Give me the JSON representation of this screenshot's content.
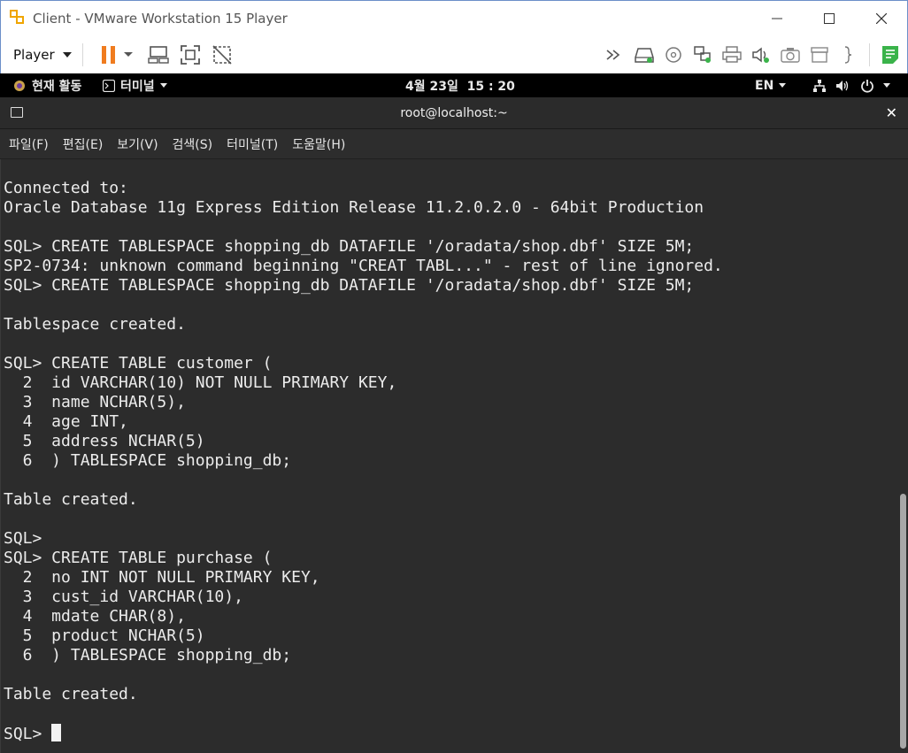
{
  "window": {
    "title": "Client - VMware Workstation 15 Player",
    "controls": [
      "minimize-icon",
      "maximize-icon",
      "close-icon"
    ]
  },
  "toolbar": {
    "player_label": "Player",
    "left_icons": [
      "pause-icon",
      "chevron-down-icon",
      "send-ctrl-alt-del-icon",
      "fit-guest-icon",
      "unity-icon"
    ],
    "right_icons": [
      "more-icon",
      "hard-disk-icon",
      "cd-dvd-icon",
      "network-adapter-icon",
      "printer-icon",
      "sound-icon",
      "camera-icon",
      "usb-icon",
      "bracket-icon",
      "message-log-icon"
    ],
    "accent_pause": "#f07c1f"
  },
  "gnome": {
    "activities": "현재 활동",
    "terminal_app": "터미널",
    "clock": "4월 23일  15 : 20",
    "lang": "EN"
  },
  "terminal": {
    "title": "root@localhost:~",
    "menu": [
      "파일(F)",
      "편집(E)",
      "보기(V)",
      "검색(S)",
      "터미널(T)",
      "도움말(H)"
    ],
    "lines": [
      "Connected to:",
      "Oracle Database 11g Express Edition Release 11.2.0.2.0 - 64bit Production",
      "",
      "SQL> CREATE TABLESPACE shopping_db DATAFILE '/oradata/shop.dbf' SIZE 5M;",
      "SP2-0734: unknown command beginning \"CREAT TABL...\" - rest of line ignored.",
      "SQL> CREATE TABLESPACE shopping_db DATAFILE '/oradata/shop.dbf' SIZE 5M;",
      "",
      "Tablespace created.",
      "",
      "SQL> CREATE TABLE customer (",
      "  2  id VARCHAR(10) NOT NULL PRIMARY KEY,",
      "  3  name NCHAR(5),",
      "  4  age INT,",
      "  5  address NCHAR(5)",
      "  6  ) TABLESPACE shopping_db;",
      "",
      "Table created.",
      "",
      "SQL>",
      "SQL> CREATE TABLE purchase (",
      "  2  no INT NOT NULL PRIMARY KEY,",
      "  3  cust_id VARCHAR(10),",
      "  4  mdate CHAR(8),",
      "  5  product NCHAR(5)",
      "  6  ) TABLESPACE shopping_db;",
      "",
      "Table created.",
      ""
    ],
    "prompt": "SQL> "
  }
}
